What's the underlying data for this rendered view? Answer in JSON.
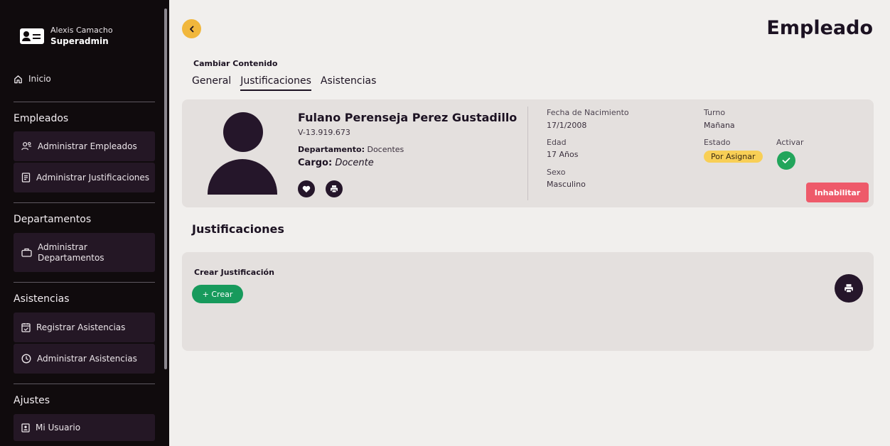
{
  "sidebar": {
    "user_name": "Alexis Camacho",
    "user_role": "Superadmin",
    "home_label": "Inicio",
    "sections": [
      {
        "title": "Empleados",
        "items": [
          "Administrar Empleados",
          "Administrar Justificaciones"
        ]
      },
      {
        "title": "Departamentos",
        "items": [
          "Administrar Departamentos"
        ]
      },
      {
        "title": "Asistencias",
        "items": [
          "Registrar Asistencias",
          "Administrar Asistencias"
        ]
      },
      {
        "title": "Ajustes",
        "items": [
          "Mi Usuario"
        ]
      }
    ],
    "departments_item_line1": "Administrar",
    "departments_item_line2": "Departamentos"
  },
  "header": {
    "title": "Empleado",
    "change_content_label": "Cambiar Contenido",
    "tabs": [
      {
        "label": "General",
        "active": false
      },
      {
        "label": "Justificaciones",
        "active": true
      },
      {
        "label": "Asistencias",
        "active": false
      }
    ]
  },
  "employee": {
    "name": "Fulano Perenseja Perez Gustadillo",
    "id": "V-13.919.673",
    "department_label": "Departamento:",
    "department": "Docentes",
    "cargo_label": "Cargo:",
    "cargo": "Docente",
    "birth_label": "Fecha de Nacimiento",
    "birth": "17/1/2008",
    "age_label": "Edad",
    "age": "17 Años",
    "sex_label": "Sexo",
    "sex": "Masculino",
    "shift_label": "Turno",
    "shift": "Mañana",
    "status_label": "Estado",
    "status": "Por Asignar",
    "activate_label": "Activar",
    "disable_label": "Inhabilitar"
  },
  "justifications": {
    "heading": "Justificaciones",
    "create_label": "Crear Justificación",
    "create_button": "+ Crear"
  },
  "colors": {
    "accent": "#f1b73c",
    "sidebar_bg": "#100b0d",
    "danger": "#ee5a6a",
    "success": "#179a5c"
  }
}
